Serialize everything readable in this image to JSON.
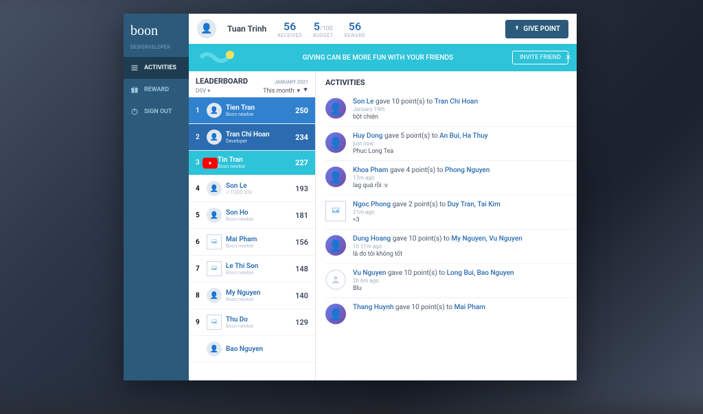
{
  "brand": "boon",
  "org": "DESIGNVELOPER",
  "nav": {
    "activities": "ACTIVITIES",
    "reward": "REWARD",
    "signout": "SIGN OUT"
  },
  "header": {
    "user": "Tuan Trinh",
    "received_val": "56",
    "received_lbl": "RECEIVED",
    "budget_val": "5",
    "budget_denom": "/100",
    "budget_lbl": "BUDGET",
    "reward_val": "56",
    "reward_lbl": "REWARD",
    "give_btn": "GIVE POINT"
  },
  "banner": {
    "text": "GIVING CAN BE MORE FUN WITH YOUR FRIENDS",
    "invite": "INVITE FRIEND"
  },
  "leaderboard": {
    "title": "LEADERBOARD",
    "date": "JANUARY 2021",
    "dsv": "DSV",
    "filter": "This month",
    "items": [
      {
        "rank": "1",
        "name": "Tien Tran",
        "role": "Boon newbie",
        "points": "250",
        "avatar": "person"
      },
      {
        "rank": "2",
        "name": "Tran Chi Hoan",
        "role": "Developer",
        "points": "234",
        "avatar": "person"
      },
      {
        "rank": "3",
        "name": "Tin Tran",
        "role": "Boon newbie",
        "points": "227",
        "avatar": "youtube"
      },
      {
        "rank": "4",
        "name": "Son Le",
        "role": "// TODO XIN",
        "points": "193",
        "avatar": "person"
      },
      {
        "rank": "5",
        "name": "Son Ho",
        "role": "Boon newbie",
        "points": "181",
        "avatar": "person"
      },
      {
        "rank": "6",
        "name": "Mai Pham",
        "role": "Boon newbie",
        "points": "156",
        "avatar": "placeholder"
      },
      {
        "rank": "7",
        "name": "Le Thi Son",
        "role": "Boon newbie",
        "points": "148",
        "avatar": "placeholder"
      },
      {
        "rank": "8",
        "name": "My Nguyen",
        "role": "Boon newbie",
        "points": "140",
        "avatar": "person"
      },
      {
        "rank": "9",
        "name": "Thu Do",
        "role": "Boon newbie",
        "points": "129",
        "avatar": "placeholder"
      },
      {
        "rank": "",
        "name": "Bao Nguyen",
        "role": "",
        "points": "",
        "avatar": ""
      }
    ]
  },
  "activities": {
    "title": "ACTIVITIES",
    "items": [
      {
        "giver": "Son Le",
        "action": "gave 10 point(s) to",
        "receivers": "Tran Chi Hoan",
        "time": "January 19th",
        "msg": "bột chiên",
        "avatar": "person"
      },
      {
        "giver": "Huy Dong",
        "action": "gave 5 point(s) to",
        "receivers": "An Bui, Ha Thuy",
        "time": "just now",
        "msg": "Phuc Long Tea",
        "avatar": "person"
      },
      {
        "giver": "Khoa Pham",
        "action": "gave 4 point(s) to",
        "receivers": "Phong Nguyen",
        "time": "17m ago",
        "msg": "lag quá rồi :v",
        "avatar": "person"
      },
      {
        "giver": "Ngoc Phong",
        "action": "gave 2 point(s) to",
        "receivers": "Duy Tran, Tai Kim",
        "time": "21m ago",
        "msg": "<3",
        "avatar": "placeholder"
      },
      {
        "giver": "Dung Hoang",
        "action": "gave 10 point(s) to",
        "receivers": "My Nguyen, Vu Nguyen",
        "time": "1h 11m ago",
        "msg": "là do tôi không tốt",
        "avatar": "person"
      },
      {
        "giver": "Vu Nguyen",
        "action": "gave 10 point(s) to",
        "receivers": "Long Bui, Bao Nguyen",
        "time": "2h 6m ago",
        "msg": "Blu",
        "avatar": "blank"
      },
      {
        "giver": "Thang Huynh",
        "action": "gave 10 point(s) to",
        "receivers": "Mai Pham",
        "time": "",
        "msg": "",
        "avatar": ""
      }
    ]
  }
}
